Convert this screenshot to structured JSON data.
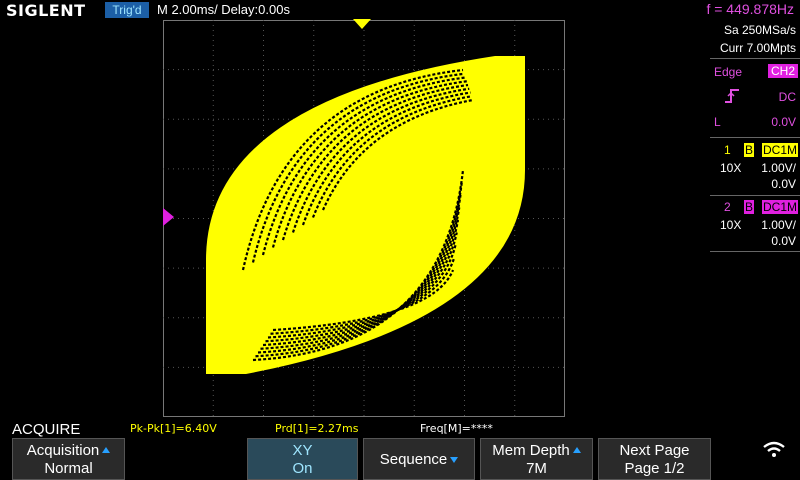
{
  "header": {
    "brand": "SIGLENT",
    "trigger_status": "Trig'd",
    "timebase": "M 2.00ms/ Delay:0.00s",
    "frequency": "f = 449.878Hz"
  },
  "acquisition_info": {
    "sample_rate": "Sa 250MSa/s",
    "memory": "Curr 7.00Mpts"
  },
  "trigger": {
    "type": "Edge",
    "source": "CH2",
    "slope_icon": "rising-edge-icon",
    "coupling": "DC",
    "level_label": "L",
    "level": "0.0V"
  },
  "channels": [
    {
      "number": "1",
      "bw_label": "B",
      "coupling": "DC1M",
      "probe": "10X",
      "scale": "1.00V/",
      "offset": "0.0V",
      "color": "#ffff00"
    },
    {
      "number": "2",
      "bw_label": "B",
      "coupling": "DC1M",
      "probe": "10X",
      "scale": "1.00V/",
      "offset": "0.0V",
      "color": "#e020e0"
    }
  ],
  "measurements": {
    "pkpk": "Pk-Pk[1]=6.40V",
    "prd": "Prd[1]=2.27ms",
    "freq": "Freq[M]=****"
  },
  "menu": {
    "title": "ACQUIRE",
    "softkeys": [
      {
        "line1": "Acquisition",
        "line2": "Normal",
        "arrow": "up"
      },
      {
        "line1": "XY",
        "line2": "On",
        "arrow": ""
      },
      {
        "line1": "Sequence",
        "line2": "",
        "arrow": "down"
      },
      {
        "line1": "Mem Depth",
        "line2": "7M",
        "arrow": "up"
      },
      {
        "line1": "Next Page",
        "line2": "Page 1/2",
        "arrow": ""
      }
    ],
    "status_icon": "wifi-icon"
  },
  "colors": {
    "ch1": "#ffff00",
    "ch2": "#e020e0",
    "accent": "#1c5fa6",
    "grid": "#555555"
  }
}
